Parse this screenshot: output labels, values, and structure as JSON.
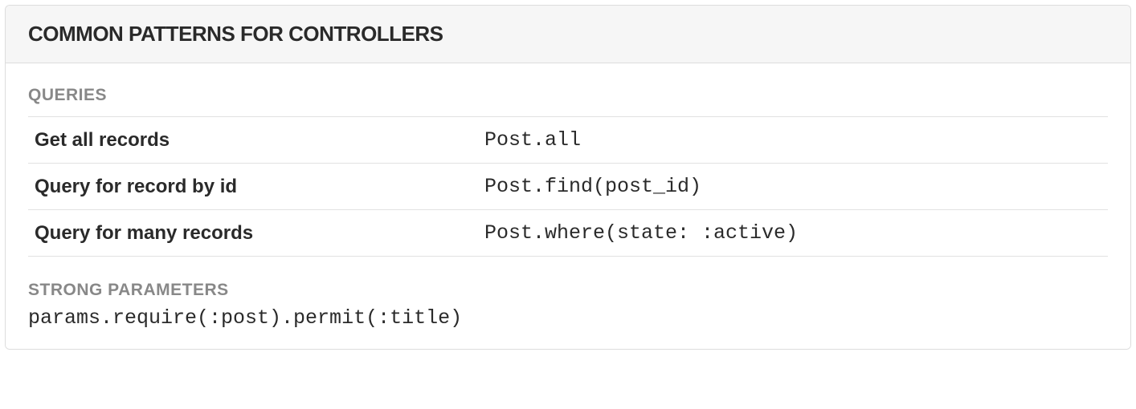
{
  "panel": {
    "title": "COMMON PATTERNS FOR CONTROLLERS"
  },
  "sections": {
    "queries": {
      "heading": "QUERIES",
      "rows": [
        {
          "label": "Get all records",
          "code": "Post.all"
        },
        {
          "label": "Query for record by id",
          "code": "Post.find(post_id)"
        },
        {
          "label": "Query for many records",
          "code": "Post.where(state: :active)"
        }
      ]
    },
    "strong_parameters": {
      "heading": "STRONG PARAMETERS",
      "code": "params.require(:post).permit(:title)"
    }
  }
}
